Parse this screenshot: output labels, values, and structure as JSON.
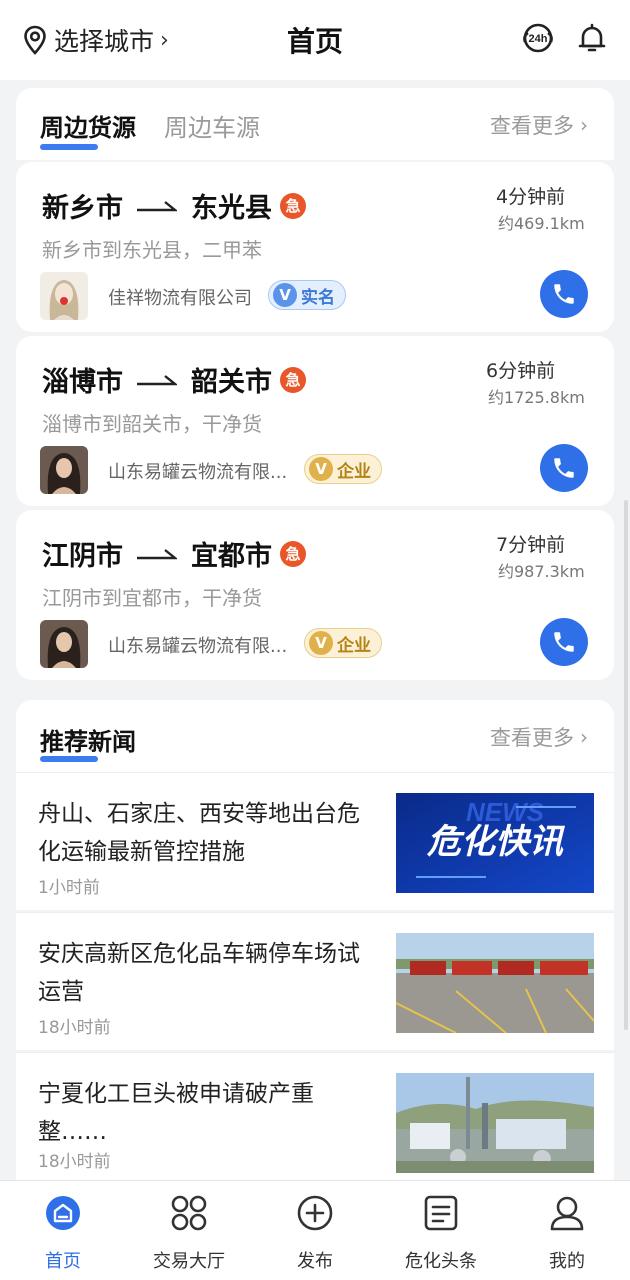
{
  "header": {
    "city_label": "选择城市",
    "title": "首页"
  },
  "cargo": {
    "tabs": [
      {
        "label": "周边货源",
        "active": true
      },
      {
        "label": "周边车源",
        "active": false
      }
    ],
    "more_label": "查看更多",
    "urgent_glyph": "急",
    "items": [
      {
        "from": "新乡市",
        "to": "东光县",
        "desc": "新乡市到东光县，二甲苯",
        "time": "4分钟前",
        "distance": "约469.1km",
        "company": "佳祥物流有限公司",
        "badge": "实名",
        "badge_type": "real"
      },
      {
        "from": "淄博市",
        "to": "韶关市",
        "desc": "淄博市到韶关市，干净货",
        "time": "6分钟前",
        "distance": "约1725.8km",
        "company": "山东易罐云物流有限...",
        "badge": "企业",
        "badge_type": "enterprise"
      },
      {
        "from": "江阴市",
        "to": "宜都市",
        "desc": "江阴市到宜都市，干净货",
        "time": "7分钟前",
        "distance": "约987.3km",
        "company": "山东易罐云物流有限...",
        "badge": "企业",
        "badge_type": "enterprise"
      }
    ]
  },
  "news": {
    "title": "推荐新闻",
    "more_label": "查看更多",
    "items": [
      {
        "title": "舟山、石家庄、西安等地出台危化运输最新管控措施",
        "time": "1小时前",
        "image_text": "危化快讯",
        "image_watermark": "NEWS"
      },
      {
        "title": "安庆高新区危化品车辆停车场试运营",
        "time": "18小时前"
      },
      {
        "title": "宁夏化工巨头被申请破产重整……",
        "time": "18小时前"
      }
    ]
  },
  "bottom_nav": {
    "items": [
      {
        "label": "首页",
        "icon": "home-icon",
        "active": true
      },
      {
        "label": "交易大厅",
        "icon": "grid-icon",
        "active": false
      },
      {
        "label": "发布",
        "icon": "plus-circle-icon",
        "active": false
      },
      {
        "label": "危化头条",
        "icon": "list-doc-icon",
        "active": false
      },
      {
        "label": "我的",
        "icon": "user-icon",
        "active": false
      }
    ]
  },
  "colors": {
    "accent": "#2f6fe8",
    "urgent": "#e8562a",
    "background": "#f2f3f5"
  }
}
